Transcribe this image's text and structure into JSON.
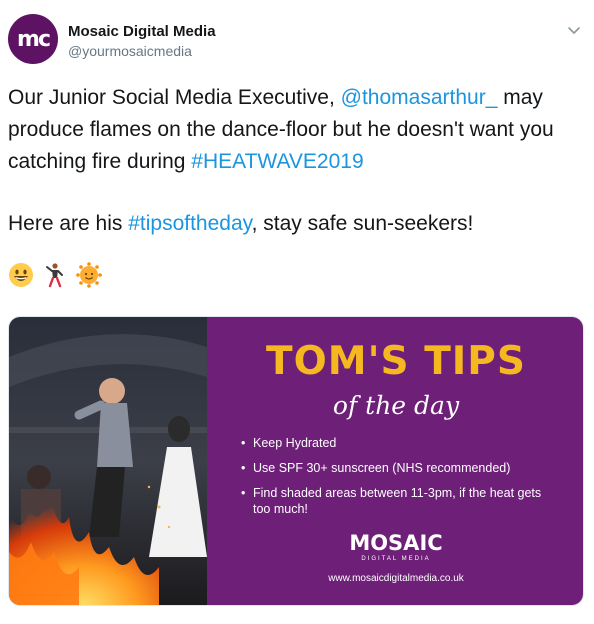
{
  "tweet": {
    "author": {
      "display_name": "Mosaic Digital Media",
      "handle": "@yourmosaicmedia",
      "avatar_text": "mc",
      "avatar_color": "#5d1263"
    },
    "menu_icon": "chevron-down-icon",
    "text": {
      "line1_prefix": "Our Junior Social Media Executive, ",
      "mention": "@thomasarthur_",
      "line1_mid": " may produce flames on the dance-floor but he doesn't want you catching fire during ",
      "hashtag1": "#HEATWAVE2019",
      "line2_prefix": "Here are his ",
      "hashtag2": "#tipsoftheday",
      "line2_suffix": ", stay safe sun-seekers!"
    },
    "emojis": [
      "grinning-face-icon",
      "man-dancing-icon",
      "sun-with-face-icon"
    ],
    "link_color": "#1b95e0"
  },
  "media": {
    "title": "TOM'S TIPS",
    "subtitle": "of the day",
    "tips": [
      "Keep Hydrated",
      "Use SPF 30+ sunscreen (NHS recommended)",
      "Find shaded areas between 11-3pm, if the heat gets too much!"
    ],
    "logo_word": "MOSAIC",
    "logo_sub": "DIGITAL MEDIA",
    "url": "www.mosaicdigitalmedia.co.uk",
    "card_color": "#6e1f78",
    "title_color": "#f5b821"
  }
}
